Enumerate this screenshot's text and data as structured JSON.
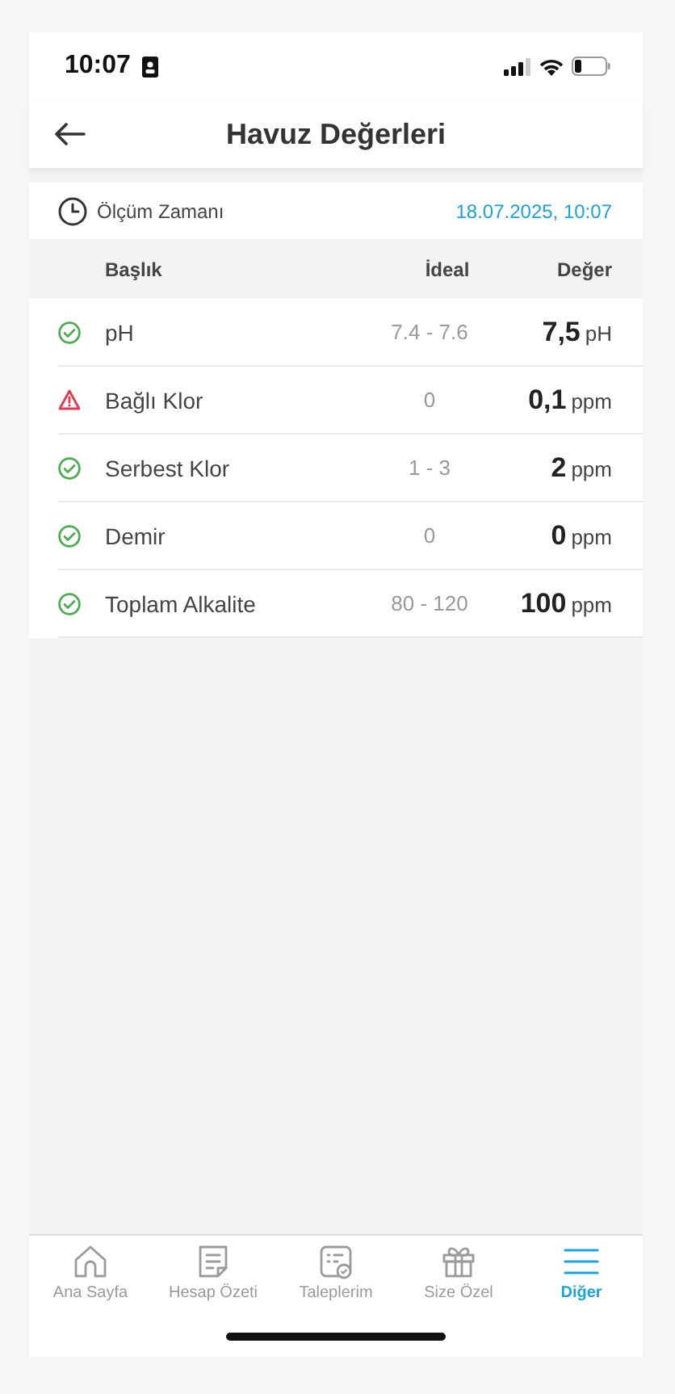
{
  "status_bar": {
    "time": "10:07"
  },
  "header": {
    "title": "Havuz Değerleri"
  },
  "measurement": {
    "label": "Ölçüm Zamanı",
    "value": "18.07.2025, 10:07"
  },
  "table": {
    "columns": [
      "Başlık",
      "İdeal",
      "Değer"
    ],
    "rows": [
      {
        "warning": false,
        "name": "pH",
        "ideal": "7.4 - 7.6",
        "value": "7,5",
        "unit": "pH"
      },
      {
        "warning": true,
        "name": "Bağlı Klor",
        "ideal": "0",
        "value": "0,1",
        "unit": "ppm"
      },
      {
        "warning": false,
        "name": "Serbest Klor",
        "ideal": "1 - 3",
        "value": "2",
        "unit": "ppm"
      },
      {
        "warning": false,
        "name": "Demir",
        "ideal": "0",
        "value": "0",
        "unit": "ppm"
      },
      {
        "warning": false,
        "name": "Toplam Alkalite",
        "ideal": "80 - 120",
        "value": "100",
        "unit": "ppm"
      }
    ]
  },
  "tab_bar": [
    {
      "kind": "home",
      "label": "Ana Sayfa",
      "selected": false
    },
    {
      "kind": "document",
      "label": "Hesap Özeti",
      "selected": false
    },
    {
      "kind": "checklist",
      "label": "Taleplerim",
      "selected": false
    },
    {
      "kind": "gift",
      "label": "Size Özel",
      "selected": false
    },
    {
      "kind": "menu",
      "label": "Diğer",
      "selected": true
    }
  ]
}
